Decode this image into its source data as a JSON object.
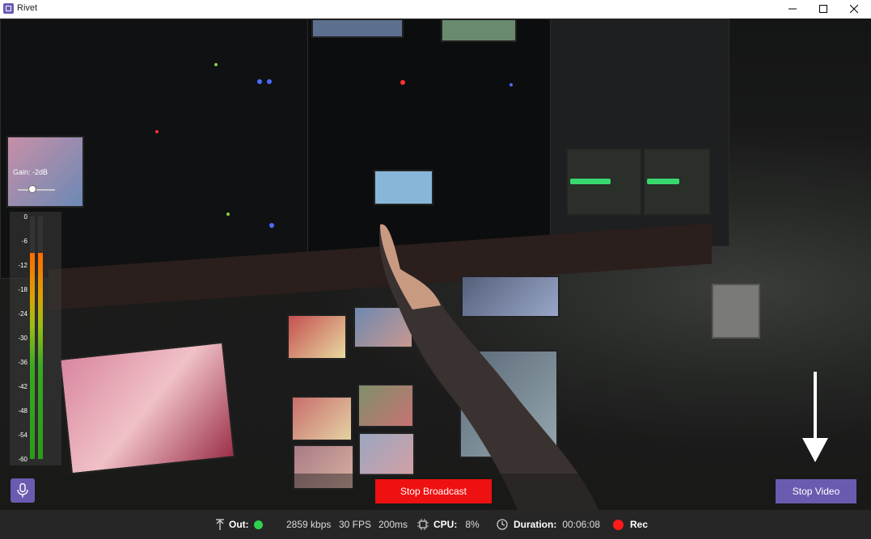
{
  "window": {
    "title": "Rivet",
    "icon": "rivet-app-icon"
  },
  "video_overlay": {
    "gain_label": "Gain: -2dB",
    "gain_slider_value_fraction": 0.35,
    "meter_scale": [
      "0",
      "-6",
      "-12",
      "-18",
      "-24",
      "-30",
      "-36",
      "-42",
      "-48",
      "-54",
      "-60"
    ],
    "meter_levels": {
      "left": 0.85,
      "right": 0.85
    }
  },
  "controls": {
    "mic_icon": "microphone-icon",
    "stop_broadcast_label": "Stop Broadcast",
    "stop_video_label": "Stop Video"
  },
  "status": {
    "out_label": "Out:",
    "out_color": "#2fd14b",
    "bitrate": "2859 kbps",
    "fps": "30 FPS",
    "latency": "200ms",
    "cpu_label": "CPU:",
    "cpu_value": "8%",
    "duration_label": "Duration:",
    "duration_value": "00:06:08",
    "rec_label": "Rec",
    "rec_color": "#ff1a1a"
  },
  "colors": {
    "accent": "#6b5bb0",
    "stop_broadcast": "#ef1111"
  }
}
